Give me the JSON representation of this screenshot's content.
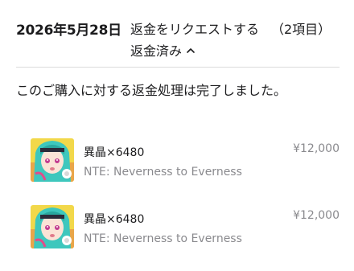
{
  "header": {
    "date": "2026年5月28日",
    "action_label": "返金をリクエストする",
    "item_count": "（2項目）",
    "status_label": "返金済み",
    "status_icon": "chevron-up-icon"
  },
  "message": "このご購入に対する返金処理は完了しました。",
  "items": [
    {
      "name": "異晶×6480",
      "game": "NTE: Neverness to Everness",
      "price": "¥12,000",
      "icon": "game-app-icon"
    },
    {
      "name": "異晶×6480",
      "game": "NTE: Neverness to Everness",
      "price": "¥12,000",
      "icon": "game-app-icon"
    }
  ],
  "colors": {
    "text_primary": "#1c1c1e",
    "text_secondary": "#8a8a8e",
    "divider": "#dcdcdc",
    "icon_hair": "#3ec7bd",
    "icon_bg": "#f2d84a"
  }
}
